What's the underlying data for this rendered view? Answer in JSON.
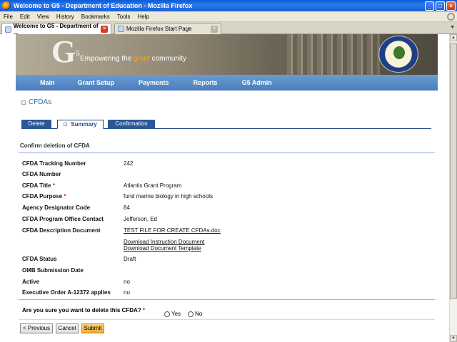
{
  "window": {
    "title": "Welcome to G5 - Department of Education - Mozilla Firefox"
  },
  "menu": [
    "File",
    "Edit",
    "View",
    "History",
    "Bookmarks",
    "Tools",
    "Help"
  ],
  "browser_tabs": [
    {
      "label": "Welcome to G5 - Department of ...",
      "active": true
    },
    {
      "label": "Mozilla Firefox Start Page",
      "active": false
    }
  ],
  "banner": {
    "logo": "G",
    "logo_sup": "5",
    "tagline_pre": "Empowering the ",
    "tagline_accent": "grant",
    "tagline_post": " community",
    "accent_color": "#f5a623"
  },
  "nav": [
    "Main",
    "Grant Setup",
    "Payments",
    "Reports",
    "G5 Admin"
  ],
  "section": "CFDAs",
  "tabs": [
    "Delete",
    "Summary",
    "Confirmation"
  ],
  "confirm_title": "Confirm deletion of CFDA",
  "fields": {
    "tracking_number": {
      "label": "CFDA Tracking Number",
      "value": "242"
    },
    "number": {
      "label": "CFDA Number",
      "value": ""
    },
    "title": {
      "label": "CFDA Title",
      "value": "Atlantis Grant Program"
    },
    "purpose": {
      "label": "CFDA Purpose",
      "value": "fund marine biology in high schools"
    },
    "agency": {
      "label": "Agency Designator Code",
      "value": "84"
    },
    "contact": {
      "label": "CFDA Program Office Contact",
      "value": "Jefferson, Ed"
    },
    "description": {
      "label": "CFDA Description Document",
      "value": "TEST FILE FOR CREATE CFDAs.doc"
    },
    "download_instruction": "Download Instruction Document",
    "download_template": "Download Document Template",
    "status": {
      "label": "CFDA Status",
      "value": "Draft"
    },
    "omb": {
      "label": "OMB Submission Date",
      "value": ""
    },
    "active": {
      "label": "Active",
      "value": "no"
    },
    "exec_order": {
      "label": "Executive Order A-12372 applies",
      "value": "no"
    }
  },
  "question": "Are you sure you want to delete this CFDA?",
  "radio": {
    "yes": "Yes",
    "no": "No"
  },
  "buttons": {
    "previous": "< Previous",
    "cancel": "Cancel",
    "submit": "Submit"
  },
  "required_marker": "*"
}
